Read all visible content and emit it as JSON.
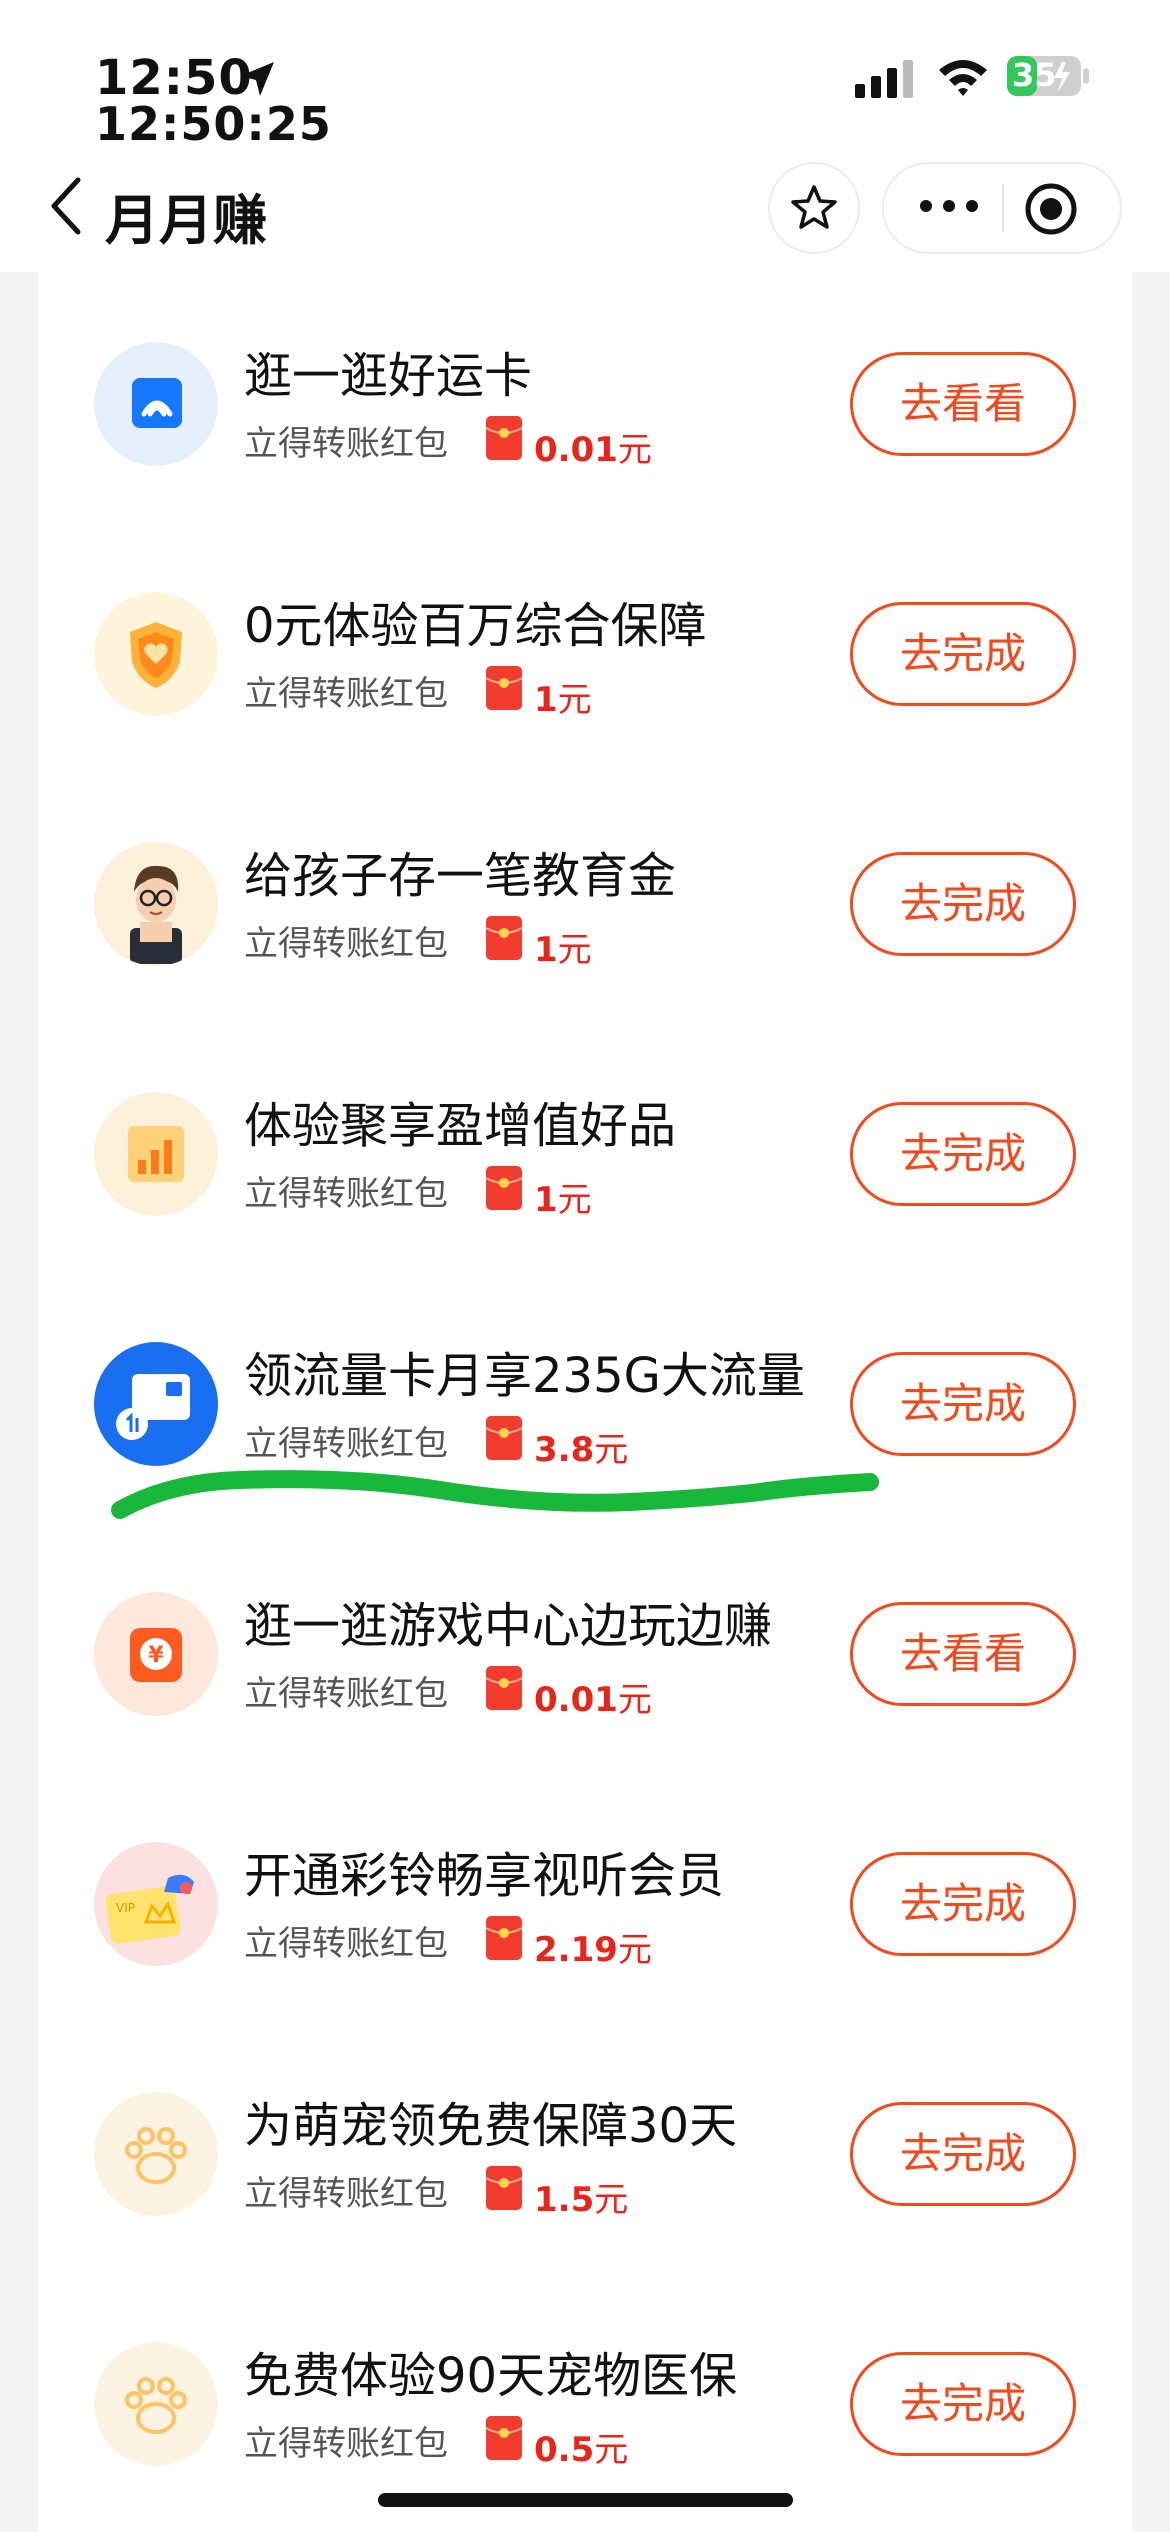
{
  "status_bar": {
    "time": "12:50",
    "time_seconds": "12:50:25",
    "battery": "35"
  },
  "nav": {
    "title": "月月赚"
  },
  "tasks": [
    {
      "title": "逛一逛好运卡",
      "subtitle": "立得转账红包",
      "amount": "0.01",
      "unit": "元",
      "button": "去看看",
      "icon": "wifi-card-icon"
    },
    {
      "title": "0元体验百万综合保障",
      "subtitle": "立得转账红包",
      "amount": "1",
      "unit": "元",
      "button": "去完成",
      "icon": "shield-heart-icon"
    },
    {
      "title": "给孩子存一笔教育金",
      "subtitle": "立得转账红包",
      "amount": "1",
      "unit": "元",
      "button": "去完成",
      "icon": "child-avatar-icon"
    },
    {
      "title": "体验聚享盈增值好品",
      "subtitle": "立得转账红包",
      "amount": "1",
      "unit": "元",
      "button": "去完成",
      "icon": "bar-chart-icon"
    },
    {
      "title": "领流量卡月享235G大流量",
      "subtitle": "立得转账红包",
      "amount": "3.8",
      "unit": "元",
      "button": "去完成",
      "icon": "sim-card-icon"
    },
    {
      "title": "逛一逛游戏中心边玩边赚",
      "subtitle": "立得转账红包",
      "amount": "0.01",
      "unit": "元",
      "button": "去看看",
      "icon": "yuan-coin-icon"
    },
    {
      "title": "开通彩铃畅享视听会员",
      "subtitle": "立得转账红包",
      "amount": "2.19",
      "unit": "元",
      "button": "去完成",
      "icon": "vip-card-icon"
    },
    {
      "title": "为萌宠领免费保障30天",
      "subtitle": "立得转账红包",
      "amount": "1.5",
      "unit": "元",
      "button": "去完成",
      "icon": "paw-icon"
    },
    {
      "title": "免费体验90天宠物医保",
      "subtitle": "立得转账红包",
      "amount": "0.5",
      "unit": "元",
      "button": "去完成",
      "icon": "paw-icon"
    }
  ],
  "colors": {
    "accent": "#f04a1d",
    "amount": "#e8251a",
    "highlight_mark": "#19b83a"
  }
}
